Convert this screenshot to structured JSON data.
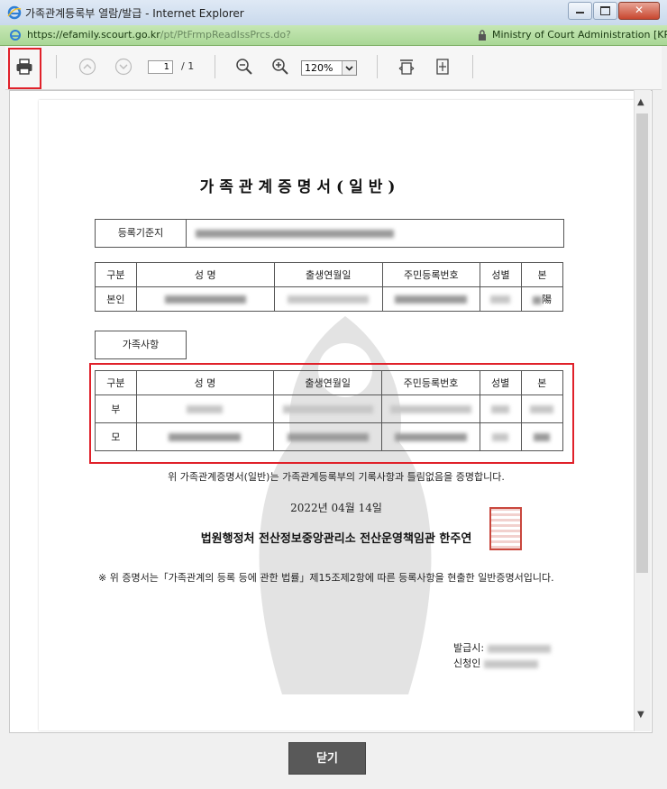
{
  "window": {
    "title": "가족관계등록부 열람/발급 - Internet Explorer",
    "url_host": "https://efamily.scourt.go.kr",
    "url_path": "/pt/PtFrmpReadIssPrcs.do?",
    "site_identity": "Ministry of Court Administration [KR]"
  },
  "toolbar": {
    "page_current": "1",
    "page_total": "/ 1",
    "zoom": "120%"
  },
  "document": {
    "title": "가족관계증명서(일반)",
    "registry_label": "등록기준지",
    "columns": [
      "구분",
      "성     명",
      "출생연월일",
      "주민등록번호",
      "성별",
      "본"
    ],
    "self_row_label": "본인",
    "self_origin_suffix": "陽",
    "family_label": "가족사항",
    "family_rows": [
      "부",
      "모"
    ],
    "certification": "위 가족관계증명서(일반)는 가족관계등록부의 기록사항과 틀림없음을 증명합니다.",
    "date": "2022년 04월 14일",
    "issuer": "법원행정처 전산정보중앙관리소 전산운영책임관 한주연",
    "note": "※ 위 증명서는「가족관계의 등록 등에 관한 법률」제15조제2항에 따른 등록사항을 현출한 일반증명서입니다.",
    "issued_by_label": "발급시:",
    "applicant_label": "신청인"
  },
  "footer": {
    "close_label": "닫기"
  },
  "colors": {
    "highlight": "#e0212a",
    "close_button": "#595959",
    "address_bar": "#a9d796"
  }
}
